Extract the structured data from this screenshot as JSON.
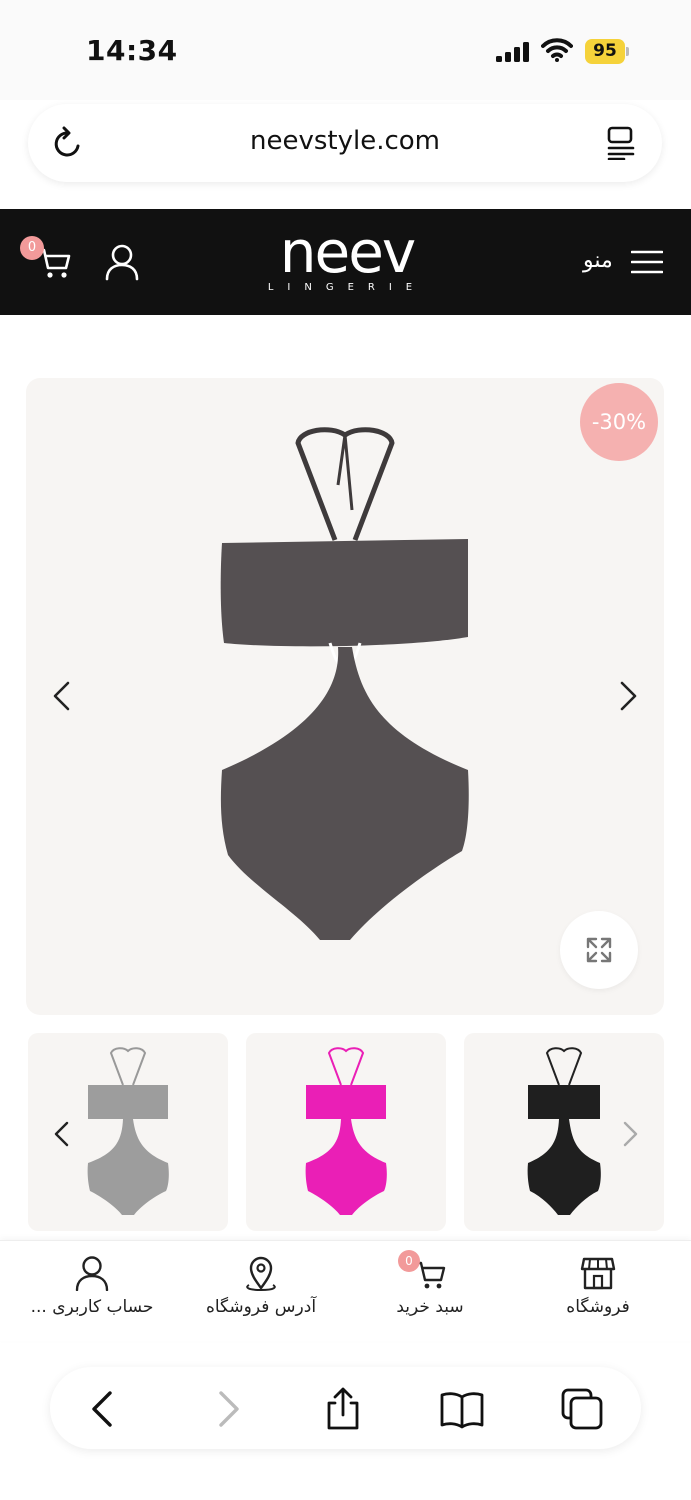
{
  "status_bar": {
    "time": "14:34",
    "battery": "95",
    "icons": [
      "signal-icon",
      "wifi-icon",
      "battery-icon"
    ]
  },
  "browser": {
    "url": "neevstyle.com",
    "icons": [
      "reload-icon",
      "reader-icon"
    ]
  },
  "site_header": {
    "logo_text": "neev",
    "logo_subtitle": "LINGERIE",
    "menu_label": "منو",
    "cart_count": "0",
    "icons": [
      "cart-icon",
      "user-icon",
      "hamburger-icon"
    ]
  },
  "product": {
    "discount_badge": "-30%",
    "main_image": "black-halter-cutout-swimsuit",
    "image_color": "#555052",
    "thumbnails": [
      {
        "name": "grey",
        "color": "#9d9d9d"
      },
      {
        "name": "pink",
        "color": "#ea1fb6"
      },
      {
        "name": "black",
        "color": "#1f1f1f"
      }
    ]
  },
  "bottom_nav": {
    "items": [
      {
        "label": "حساب کاربری ...",
        "icon": "user-icon"
      },
      {
        "label": "آدرس فروشگاه",
        "icon": "location-pin-icon"
      },
      {
        "label": "سبد خرید",
        "icon": "cart-icon",
        "badge": "0"
      },
      {
        "label": "فروشگاه",
        "icon": "store-icon"
      }
    ]
  },
  "browser_toolbar": {
    "icons": [
      "back-icon",
      "forward-icon",
      "share-icon",
      "bookmarks-icon",
      "tabs-icon"
    ]
  },
  "colors": {
    "header_bg": "#111111",
    "badge_pink": "#f29a9a",
    "discount_pink": "#f5b1b0",
    "battery_yellow": "#f5d23a"
  }
}
